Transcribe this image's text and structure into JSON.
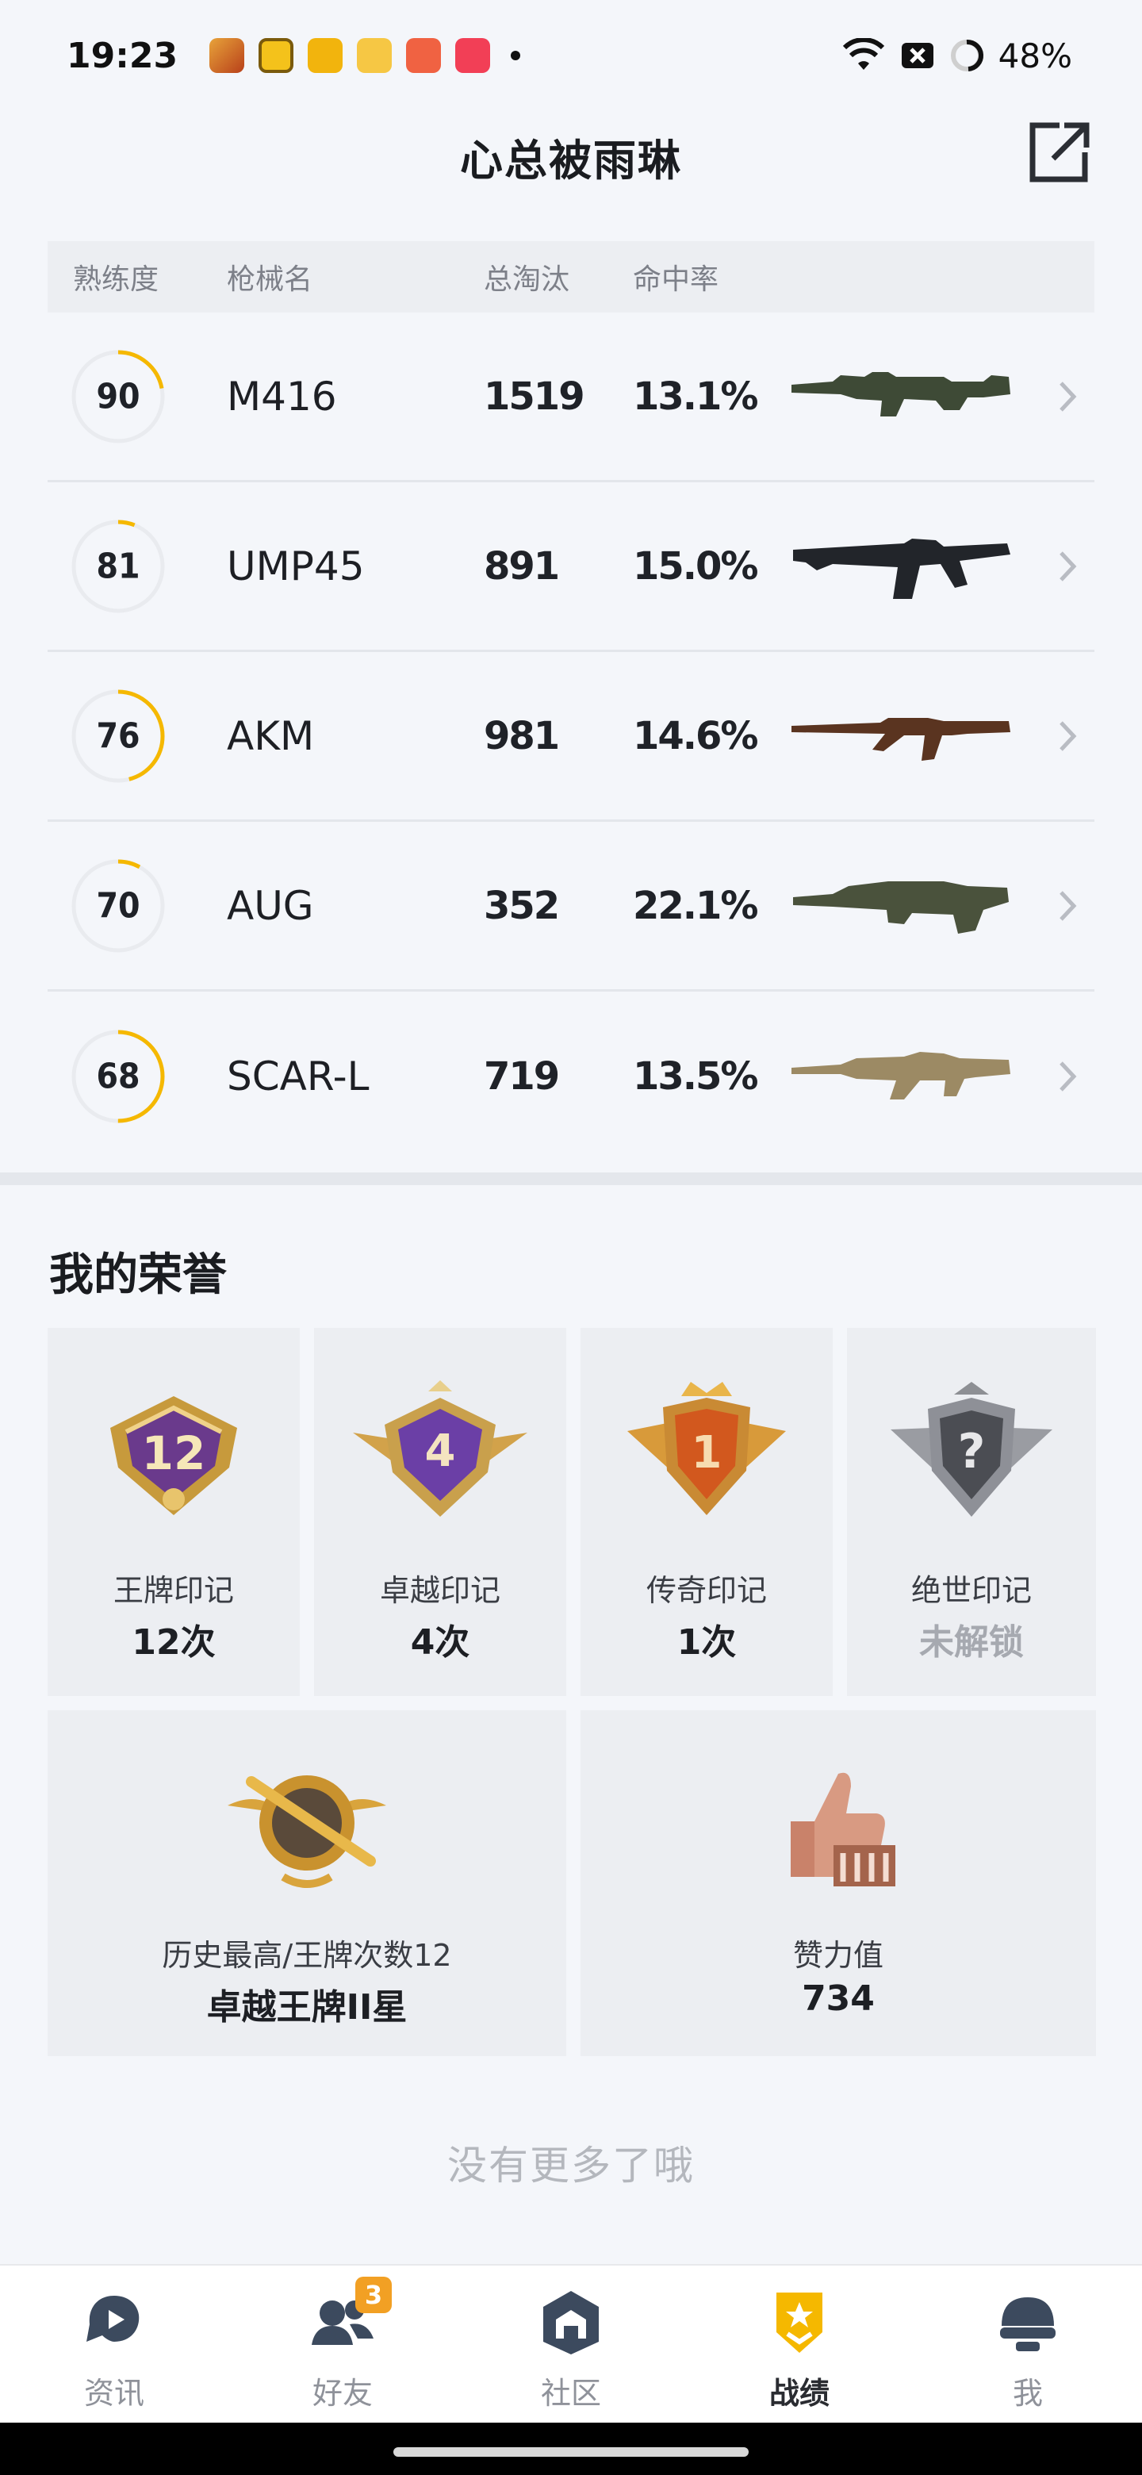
{
  "status_bar": {
    "time": "19:23",
    "battery": "48%",
    "app_icons": [
      "game-hero-icon",
      "target-app-icon",
      "news-app-icon",
      "book-app-icon",
      "video-app-icon",
      "music-app-icon"
    ]
  },
  "header": {
    "title": "心总被雨琳",
    "share_icon": "share-external-icon"
  },
  "table": {
    "columns": [
      "熟练度",
      "枪械名",
      "总淘汰",
      "命中率"
    ],
    "rows": [
      {
        "mastery": "90",
        "mastery_fraction": 0.22,
        "name": "M416",
        "kills": "1519",
        "hit_rate": "13.1%",
        "gun_icon": "m416-rifle-icon"
      },
      {
        "mastery": "81",
        "mastery_fraction": 0.06,
        "name": "UMP45",
        "kills": "891",
        "hit_rate": "15.0%",
        "gun_icon": "ump45-smg-icon"
      },
      {
        "mastery": "76",
        "mastery_fraction": 0.46,
        "name": "AKM",
        "kills": "981",
        "hit_rate": "14.6%",
        "gun_icon": "akm-rifle-icon"
      },
      {
        "mastery": "70",
        "mastery_fraction": 0.08,
        "name": "AUG",
        "kills": "352",
        "hit_rate": "22.1%",
        "gun_icon": "aug-rifle-icon"
      },
      {
        "mastery": "68",
        "mastery_fraction": 0.5,
        "name": "SCAR-L",
        "kills": "719",
        "hit_rate": "13.5%",
        "gun_icon": "scar-l-rifle-icon"
      }
    ]
  },
  "honors": {
    "title": "我的荣誉",
    "marks": [
      {
        "label": "王牌印记",
        "value": "12次",
        "badge_number": "12",
        "icon": "ace-mark-badge-icon"
      },
      {
        "label": "卓越印记",
        "value": "4次",
        "badge_number": "4",
        "icon": "excellent-mark-badge-icon"
      },
      {
        "label": "传奇印记",
        "value": "1次",
        "badge_number": "1",
        "icon": "legend-mark-badge-icon"
      },
      {
        "label": "绝世印记",
        "value": "未解锁",
        "badge_number": "?",
        "icon": "peerless-mark-badge-icon",
        "locked": true
      }
    ],
    "highest": {
      "label": "历史最高/王牌次数12",
      "value": "卓越王牌II星",
      "icon": "ace-rank-emblem-icon"
    },
    "likes": {
      "label": "赞力值",
      "value": "734",
      "icon": "thumbs-up-trophy-icon"
    }
  },
  "footer_text": "没有更多了哦",
  "bottom_nav": {
    "items": [
      {
        "label": "资讯",
        "icon": "news-play-icon",
        "active": false
      },
      {
        "label": "好友",
        "icon": "friends-icon",
        "active": false,
        "badge": "3"
      },
      {
        "label": "社区",
        "icon": "community-house-icon",
        "active": false
      },
      {
        "label": "战绩",
        "icon": "stats-shield-icon",
        "active": true
      },
      {
        "label": "我",
        "icon": "helmet-profile-icon",
        "active": false
      }
    ]
  },
  "colors": {
    "accent": "#f5b800",
    "ring_track": "#e9ebef",
    "background": "#f4f6fa"
  }
}
